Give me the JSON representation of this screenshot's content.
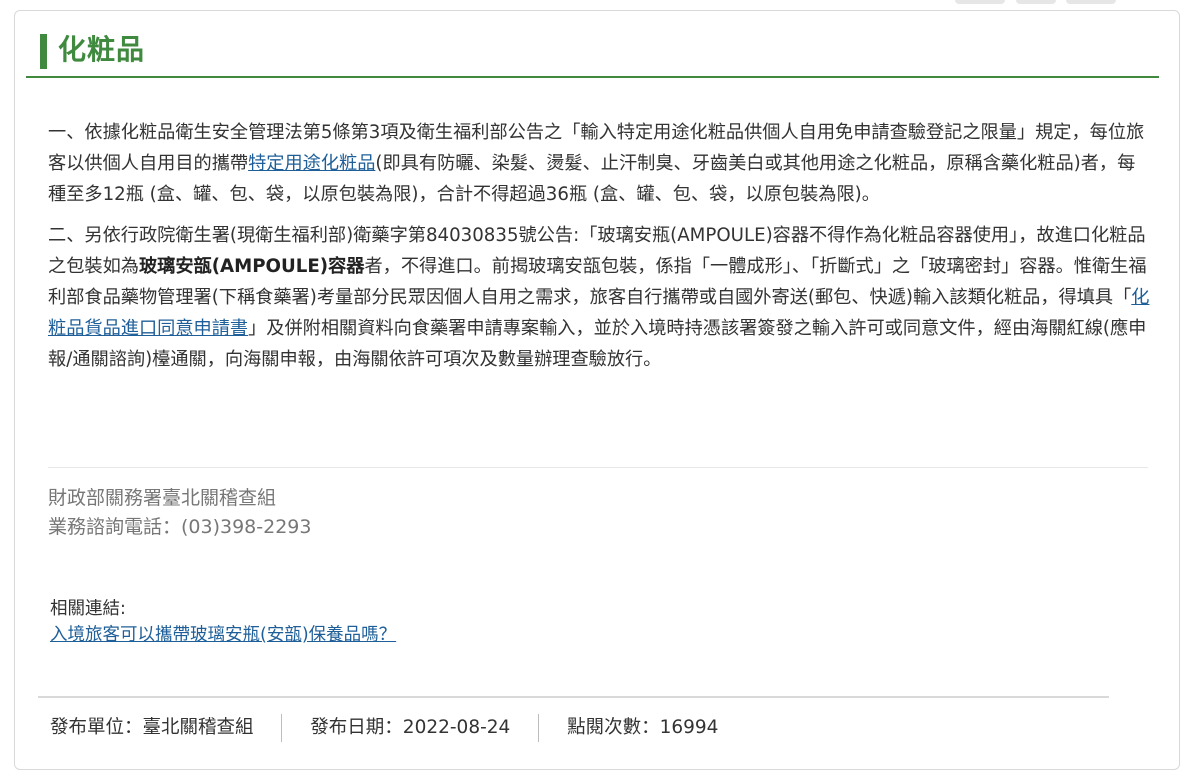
{
  "section": {
    "title": "化粧品"
  },
  "paragraph1": {
    "text_a": "一、依據化粧品衛生安全管理法第5條第3項及衛生福利部公告之「輸入特定用途化粧品供個人自用免申請查驗登記之限量」規定，每位旅客以供個人自用目的攜帶",
    "link": "特定用途化粧品",
    "text_b": "(即具有防曬、染髮、燙髮、止汗制臭、牙齒美白或其他用途之化粧品，原稱含藥化粧品)者，每種至多12瓶 (盒、罐、包、袋，以原包裝為限)，合計不得超過36瓶 (盒、罐、包、袋，以原包裝為限)。"
  },
  "paragraph2": {
    "text_a": "二、另依行政院衛生署(現衛生福利部)衛藥字第84030835號公告:「玻璃安瓶(AMPOULE)容器不得作為化粧品容器使用」，故進口化粧品之包裝如為",
    "bold": "玻璃安瓿(AMPOULE)容器",
    "text_b": "者，不得進口。前揭玻璃安瓿包裝，係指「一體成形」、「折斷式」之「玻璃密封」容器。惟衛生福利部食品藥物管理署(下稱食藥署)考量部分民眾因個人自用之需求，旅客自行攜帶或自國外寄送(郵包、快遞)輸入該類化粧品，得填具「",
    "link": "化粧品貨品進口同意申請書",
    "text_c": "」及併附相關資料向食藥署申請專案輸入，並於入境時持憑該署簽發之輸入許可或同意文件，經由海關紅線(應申報/通關諮詢)檯通關，向海關申報，由海關依許可項次及數量辦理查驗放行。"
  },
  "contact": {
    "org": "財政部關務署臺北關稽查組",
    "phone": "業務諮詢電話：(03)398-2293"
  },
  "related": {
    "label": "相關連結:",
    "link": "入境旅客可以攜帶玻璃安瓶(安瓿)保養品嗎？"
  },
  "footer": {
    "unit": "發布單位：臺北關稽查組",
    "date": "發布日期：2022-08-24",
    "views": "點閱次數：16994"
  }
}
